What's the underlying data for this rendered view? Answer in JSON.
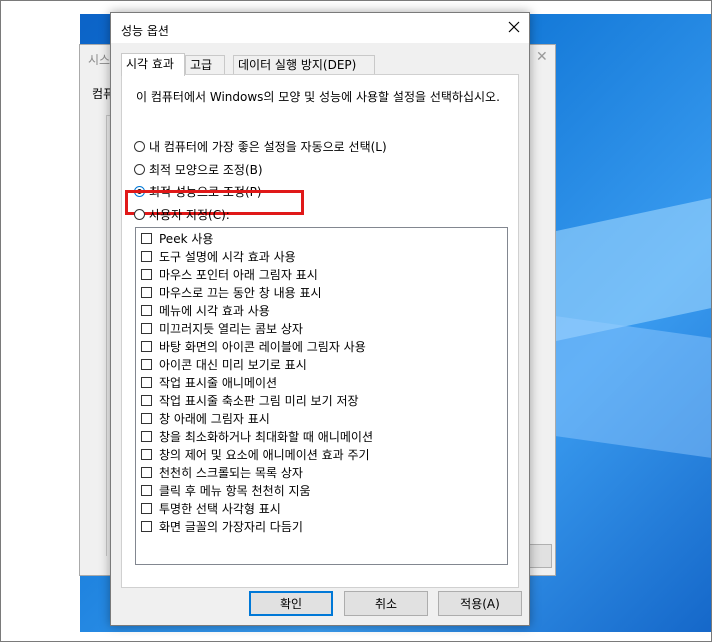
{
  "background_window": {
    "title": "시스",
    "tab": "컴퓨"
  },
  "dialog": {
    "title": "성능 옵션",
    "close_glyph": "✕",
    "tabs": [
      {
        "label": "시각 효과",
        "active": true
      },
      {
        "label": "고급",
        "active": false
      },
      {
        "label": "데이터 실행 방지(DEP)",
        "active": false
      }
    ],
    "description": "이 컴퓨터에서 Windows의 모양 및 성능에 사용할 설정을 선택하십시오.",
    "radios": [
      {
        "label": "내 컴퓨터에 가장 좋은 설정을 자동으로 선택(L)",
        "checked": false
      },
      {
        "label": "최적 모양으로 조정(B)",
        "checked": false
      },
      {
        "label": "최적 성능으로 조정(P)",
        "checked": true
      },
      {
        "label": "사용자 지정(C):",
        "checked": false
      }
    ],
    "effects": [
      {
        "label": "Peek 사용",
        "checked": false
      },
      {
        "label": "도구 설명에 시각 효과 사용",
        "checked": false
      },
      {
        "label": "마우스 포인터 아래 그림자 표시",
        "checked": false
      },
      {
        "label": "마우스로 끄는 동안 창 내용 표시",
        "checked": false
      },
      {
        "label": "메뉴에 시각 효과 사용",
        "checked": false
      },
      {
        "label": "미끄러지듯 열리는 콤보 상자",
        "checked": false
      },
      {
        "label": "바탕 화면의 아이콘 레이블에 그림자 사용",
        "checked": false
      },
      {
        "label": "아이콘 대신 미리 보기로 표시",
        "checked": false
      },
      {
        "label": "작업 표시줄 애니메이션",
        "checked": false
      },
      {
        "label": "작업 표시줄 축소판 그림 미리 보기 저장",
        "checked": false
      },
      {
        "label": "창 아래에 그림자 표시",
        "checked": false
      },
      {
        "label": "창을 최소화하거나 최대화할 때 애니메이션",
        "checked": false
      },
      {
        "label": "창의 제어 및 요소에 애니메이션 효과 주기",
        "checked": false
      },
      {
        "label": "천천히 스크롤되는 목록 상자",
        "checked": false
      },
      {
        "label": "클릭 후 메뉴 항목 천천히 지움",
        "checked": false
      },
      {
        "label": "투명한 선택 사각형 표시",
        "checked": false
      },
      {
        "label": "화면 글꼴의 가장자리 다듬기",
        "checked": false
      }
    ],
    "buttons": {
      "ok": "확인",
      "cancel": "취소",
      "apply": "적용(A)"
    }
  },
  "colors": {
    "highlight_box": "#e01818",
    "desktop_blue": "#1479d8",
    "accent": "#0078d7"
  }
}
